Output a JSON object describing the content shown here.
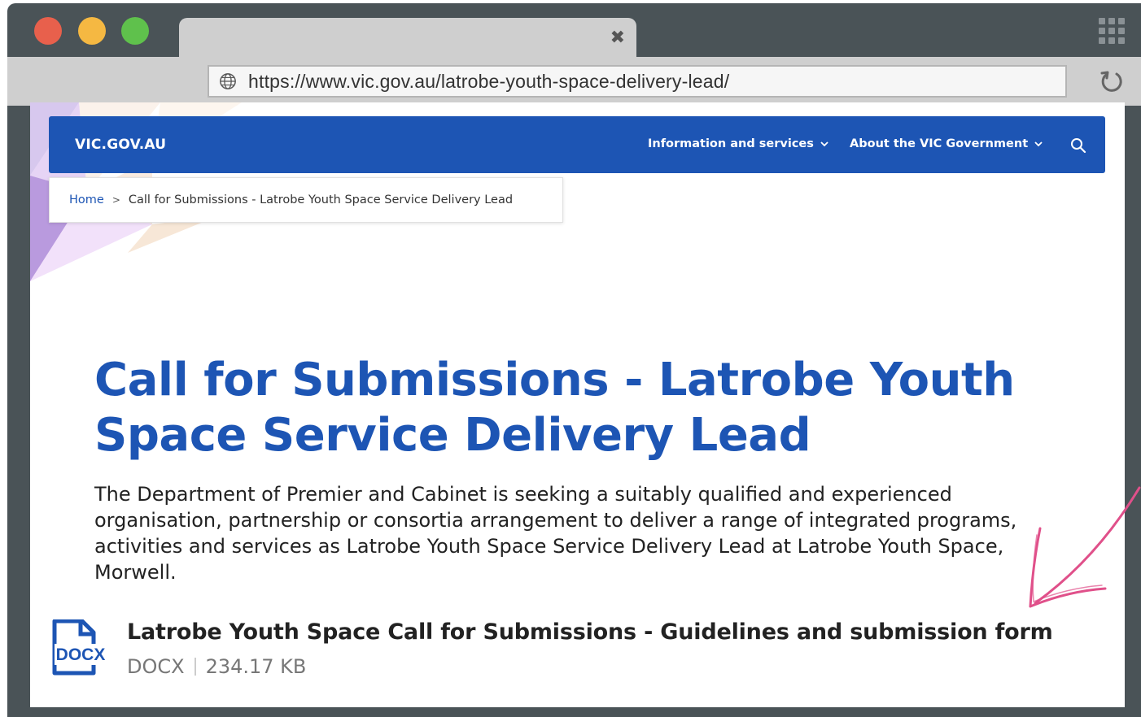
{
  "browser": {
    "url": "https://www.vic.gov.au/latrobe-youth-space-delivery-lead/",
    "tab_close_glyph": "✖"
  },
  "site": {
    "logo": "VIC.GOV.AU",
    "nav": [
      {
        "label": "Information and services"
      },
      {
        "label": "About the VIC Government"
      }
    ],
    "accent_color": "#1d55b4"
  },
  "breadcrumb": {
    "home": "Home",
    "separator": ">",
    "current": "Call for Submissions - Latrobe Youth Space Service Delivery Lead"
  },
  "page": {
    "title": "Call for Submissions - Latrobe Youth Space Service Delivery Lead",
    "intro": "The Department of Premier and Cabinet is seeking a suitably qualified and experienced organisation, partnership or consortia arrangement to deliver a range of integrated programs, activities and services as Latrobe Youth Space Service Delivery Lead at Latrobe Youth Space, Morwell."
  },
  "document": {
    "icon_label": "DOCX",
    "title": "Latrobe Youth Space Call for Submissions - Guidelines and submission form",
    "type": "DOCX",
    "size": "234.17 KB"
  }
}
